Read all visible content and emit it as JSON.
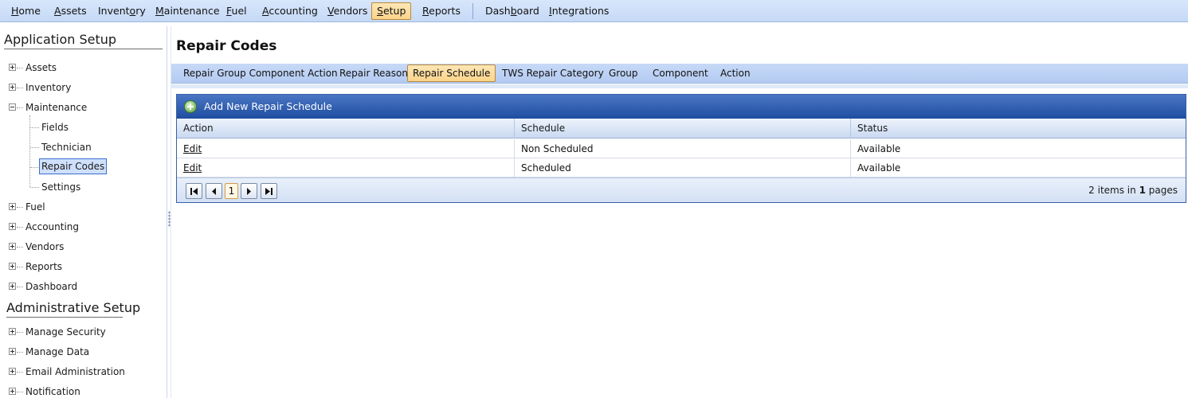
{
  "topnav": {
    "items": [
      {
        "pre": "",
        "ul": "H",
        "post": "ome"
      },
      {
        "pre": "",
        "ul": "A",
        "post": "ssets"
      },
      {
        "pre": "Invent",
        "ul": "o",
        "post": "ry"
      },
      {
        "pre": "",
        "ul": "M",
        "post": "aintenance"
      },
      {
        "pre": "",
        "ul": "F",
        "post": "uel"
      },
      {
        "pre": "",
        "ul": "A",
        "post": "ccounting"
      },
      {
        "pre": "",
        "ul": "V",
        "post": "endors"
      },
      {
        "pre": "",
        "ul": "S",
        "post": "etup"
      },
      {
        "pre": "",
        "ul": "R",
        "post": "eports"
      },
      {
        "pre": "Dash",
        "ul": "b",
        "post": "oard"
      },
      {
        "pre": "",
        "ul": "I",
        "post": "ntegrations"
      }
    ],
    "active": "Setup"
  },
  "sidebar": {
    "app_setup_title": "Application Setup",
    "admin_setup_title": "Administrative Setup",
    "app_items": [
      "Assets",
      "Inventory",
      "Maintenance",
      "Fields",
      "Technician",
      "Repair Codes",
      "Settings",
      "Fuel",
      "Accounting",
      "Vendors",
      "Reports",
      "Dashboard"
    ],
    "admin_items": [
      "Manage Security",
      "Manage Data",
      "Email Administration",
      "Notification"
    ],
    "selected": "Repair Codes"
  },
  "main": {
    "title": "Repair Codes",
    "tabs": [
      "Repair Group Component Action",
      "Repair Reason",
      "Repair Schedule",
      "TWS Repair Category",
      "Group",
      "Component",
      "Action"
    ],
    "active_tab": "Repair Schedule"
  },
  "grid": {
    "add_label": "Add New Repair Schedule",
    "columns": [
      "Action",
      "Schedule",
      "Status"
    ],
    "rows": [
      {
        "action": "Edit",
        "schedule": "Non Scheduled",
        "status": "Available"
      },
      {
        "action": "Edit",
        "schedule": "Scheduled",
        "status": "Available"
      }
    ],
    "pager": {
      "current_page": "1",
      "count": "2",
      "items_in": "items in",
      "pages": "1",
      "pages_suffix": "pages"
    }
  },
  "icons": {
    "add": "add-circle-icon",
    "first": "first-page-icon",
    "prev": "prev-page-icon",
    "next": "next-page-icon",
    "last": "last-page-icon",
    "expand": "tree-expand-icon",
    "collapse": "tree-collapse-icon"
  },
  "colors": {
    "active_tab": "#fbd48a",
    "grid_header": "#1f4da0",
    "nav_bg": "#c5d9f6"
  }
}
